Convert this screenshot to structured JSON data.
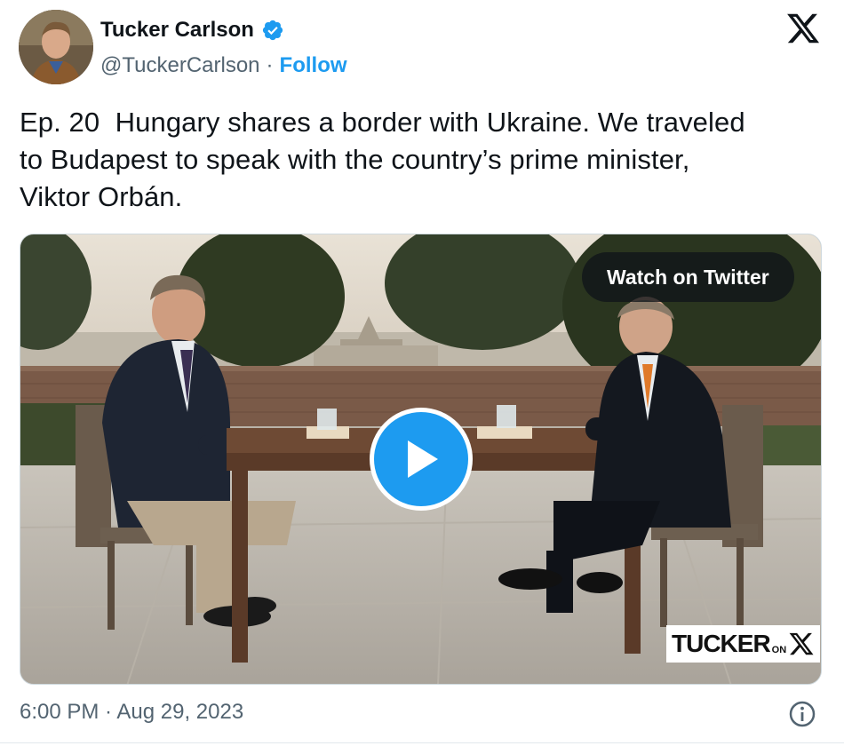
{
  "author": {
    "display_name": "Tucker Carlson",
    "handle": "@TuckerCarlson",
    "separator": "·",
    "follow_label": "Follow",
    "verified": true
  },
  "tweet": {
    "text": "Ep. 20  Hungary shares a border with Ukraine. We traveled\nto Budapest to speak with the country’s prime minister,\nViktor Orbán."
  },
  "media": {
    "type": "video",
    "watch_label": "Watch on Twitter",
    "watermark": {
      "main": "TUCKER",
      "on": "ON"
    }
  },
  "footer": {
    "timestamp": "6:00 PM · Aug 29, 2023"
  },
  "icons": {
    "verified": "verified-badge-icon",
    "platform": "x-logo-icon",
    "play": "play-icon",
    "info": "info-icon"
  },
  "colors": {
    "accent": "#1d9bf0",
    "text": "#0f1419",
    "secondary": "#536471"
  }
}
